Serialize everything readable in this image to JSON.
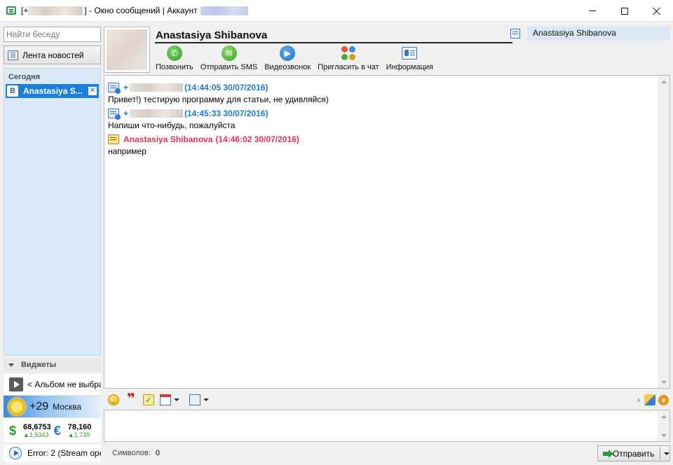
{
  "window": {
    "title_prefix": "[+",
    "title_middle": "] - Окно сообщений | Аккаунт",
    "controls": [
      "minimize-icon",
      "maximize-icon",
      "close-icon"
    ]
  },
  "sidebar": {
    "search_placeholder": "Найти беседу",
    "news_button": "Лента новостей",
    "group_label": "Сегодня",
    "conversations": [
      {
        "badge": "B",
        "name": "Anastasiya S...",
        "selected": true
      }
    ],
    "widgets_label": "Виджеты",
    "album_text": "< Альбом не выбран",
    "weather": {
      "temp": "+29",
      "city": "Москва"
    },
    "currency": [
      {
        "symbol": "$",
        "value": "68,6753",
        "delta": "▲1,5343"
      },
      {
        "symbol": "€",
        "value": "78,160",
        "delta": "▲1,739"
      }
    ],
    "error_text": "Error: 2 (Stream ope"
  },
  "contact": {
    "name": "Anastasiya Shibanova",
    "account_name": "Anastasiya Shibanova",
    "actions": [
      {
        "label": "Позвонить",
        "icon": "phone-icon"
      },
      {
        "label": "Отправить SMS",
        "icon": "sms-icon"
      },
      {
        "label": "Видеозвонок",
        "icon": "video-call-icon"
      },
      {
        "label": "Пригласить в чат",
        "icon": "invite-icon"
      },
      {
        "label": "Информация",
        "icon": "info-card-icon"
      }
    ]
  },
  "messages": [
    {
      "sender": "+",
      "time": "(14:44:05 30/07/2016)",
      "text": "Привет!) тестирую программу для статьи, не удивляйся)",
      "own": true
    },
    {
      "sender": "+",
      "time": "(14:45:33 30/07/2016)",
      "text": "Напиши что-нибудь, пожалуйста",
      "own": true
    },
    {
      "sender": "Anastasiya Shibanova",
      "time": "(14:46:02 30/07/2016)",
      "text": "например",
      "own": false
    }
  ],
  "composer": {
    "char_label": "Символов:",
    "char_count": "0",
    "send_label": "Отправить"
  },
  "colors": {
    "own_sender": "#1f78c8",
    "other_sender": "#e0334f",
    "selected_conversation": "#1e7fd8"
  }
}
